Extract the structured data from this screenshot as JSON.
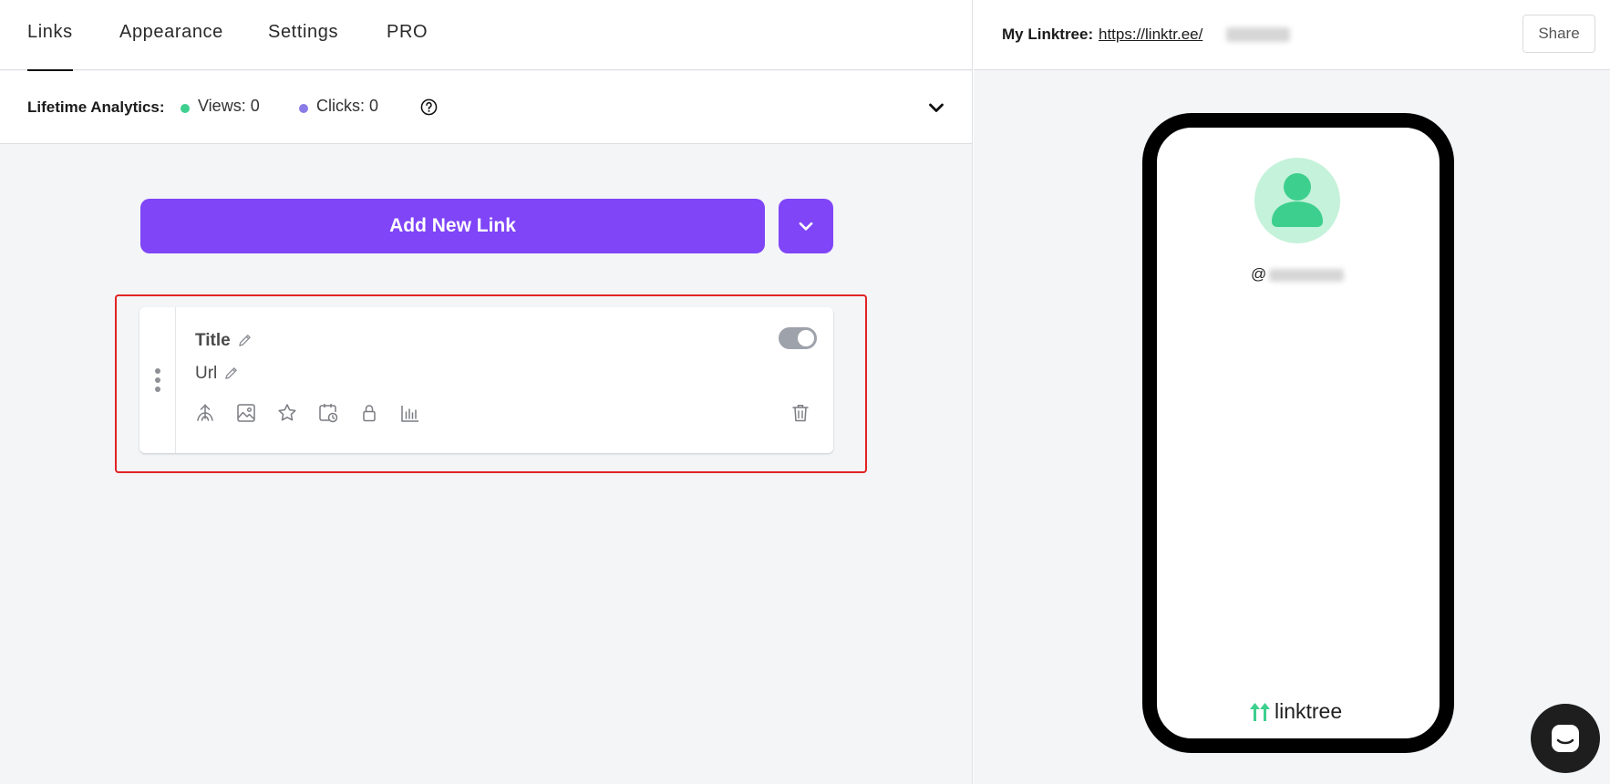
{
  "tabs": [
    {
      "label": "Links",
      "active": true
    },
    {
      "label": "Appearance",
      "active": false
    },
    {
      "label": "Settings",
      "active": false
    },
    {
      "label": "PRO",
      "active": false
    }
  ],
  "analytics": {
    "label": "Lifetime Analytics:",
    "views": "Views: 0",
    "clicks": "Clicks: 0",
    "colors": {
      "views": "#3dcf8e",
      "clicks": "#8b7be8"
    },
    "help_icon": "question-circle-icon",
    "expand_icon": "chevron-down-icon"
  },
  "add_link": {
    "label": "Add New Link",
    "more_icon": "chevron-down-icon",
    "color": "#7f45f7"
  },
  "link_card": {
    "title": "Title",
    "url": "Url",
    "enabled": true,
    "tools": [
      "redirect-icon",
      "image-icon",
      "star-icon",
      "schedule-icon",
      "lock-icon",
      "analytics-icon"
    ],
    "delete_icon": "trash-icon"
  },
  "preview": {
    "label": "My Linktree:",
    "url": "https://linktr.ee/",
    "share_label": "Share",
    "username": "@",
    "brand": "linktree",
    "brand_color": "#3dcf8e"
  },
  "chat_icon": "chat-bubble-icon"
}
